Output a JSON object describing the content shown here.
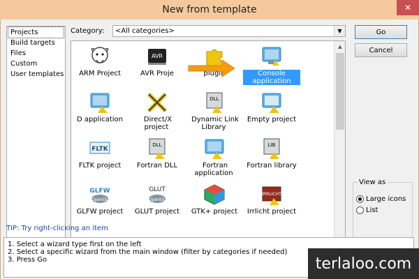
{
  "window": {
    "title": "New from template",
    "close_symbol": "✕"
  },
  "left_list": {
    "items": [
      {
        "label": "Projects",
        "selected": true
      },
      {
        "label": "Build targets"
      },
      {
        "label": "Files"
      },
      {
        "label": "Custom"
      },
      {
        "label": "User templates"
      }
    ]
  },
  "category": {
    "label": "Category:",
    "value": "<All categories>"
  },
  "tiles": [
    {
      "label": "ARM Project",
      "icon": "gnu-icon"
    },
    {
      "label": "AVR Proje",
      "icon": "avr-icon"
    },
    {
      "label": "plugin",
      "icon": "puzzle-icon"
    },
    {
      "label": "Console application",
      "icon": "console-icon",
      "selected": true
    },
    {
      "label": "D application",
      "icon": "monitor-icon"
    },
    {
      "label": "Direct/X project",
      "icon": "directx-icon"
    },
    {
      "label": "Dynamic Link Library",
      "icon": "dll-icon"
    },
    {
      "label": "Empty project",
      "icon": "empty-icon"
    },
    {
      "label": "FLTK project",
      "icon": "fltk-icon"
    },
    {
      "label": "Fortran DLL",
      "icon": "fortran-dll-icon"
    },
    {
      "label": "Fortran application",
      "icon": "monitor-icon"
    },
    {
      "label": "Fortran library",
      "icon": "lib-icon"
    },
    {
      "label": "GLFW project",
      "icon": "glfw-icon"
    },
    {
      "label": "GLUT project",
      "icon": "glut-icon"
    },
    {
      "label": "GTK+ project",
      "icon": "gtk-icon"
    },
    {
      "label": "Irrlicht project",
      "icon": "irrlicht-icon"
    }
  ],
  "buttons": {
    "go": "Go",
    "cancel": "Cancel"
  },
  "view_as": {
    "legend": "View as",
    "options": [
      {
        "label": "Large icons",
        "selected": true
      },
      {
        "label": "List",
        "selected": false
      }
    ]
  },
  "tip": "TIP: Try right-clicking an item",
  "instructions": [
    "1. Select a wizard type first on the left",
    "2. Select a specific wizard from the main window (filter by categories if needed)",
    "3. Press Go"
  ],
  "watermark": "terlaloo.com",
  "colors": {
    "title_bar": "#f6c99c",
    "selection": "#3399ff",
    "tip_text": "#1d3fb0",
    "arrow": "#f39c12"
  }
}
